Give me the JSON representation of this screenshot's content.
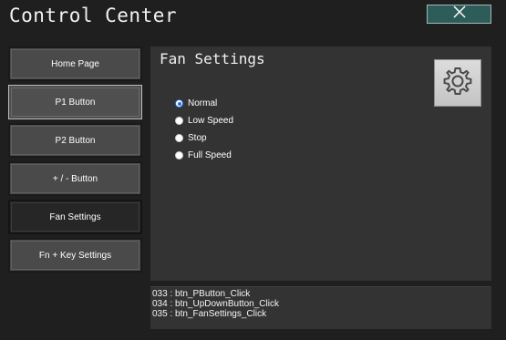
{
  "window": {
    "title": "Control Center",
    "close_icon": "close-icon"
  },
  "sidebar": {
    "items": [
      {
        "label": "Home Page",
        "state": "normal"
      },
      {
        "label": "P1 Button",
        "state": "hover"
      },
      {
        "label": "P2 Button",
        "state": "normal"
      },
      {
        "label": "+ / - Button",
        "state": "normal"
      },
      {
        "label": "Fan Settings",
        "state": "active"
      },
      {
        "label": "Fn + Key Settings",
        "state": "normal"
      }
    ]
  },
  "panel": {
    "title": "Fan Settings",
    "settings_icon": "gear-icon",
    "options": [
      {
        "label": "Normal",
        "checked": true
      },
      {
        "label": "Low Speed",
        "checked": false
      },
      {
        "label": "Stop",
        "checked": false
      },
      {
        "label": "Full Speed",
        "checked": false
      }
    ]
  },
  "log": {
    "lines": [
      "033 : btn_PButton_Click",
      "034 : btn_UpDownButton_Click",
      "035 : btn_FanSettings_Click"
    ]
  },
  "colors": {
    "background": "#1f1f1f",
    "panel": "#333333",
    "close_button": "#2e5d59",
    "radio_accent": "#2a6fd6"
  }
}
